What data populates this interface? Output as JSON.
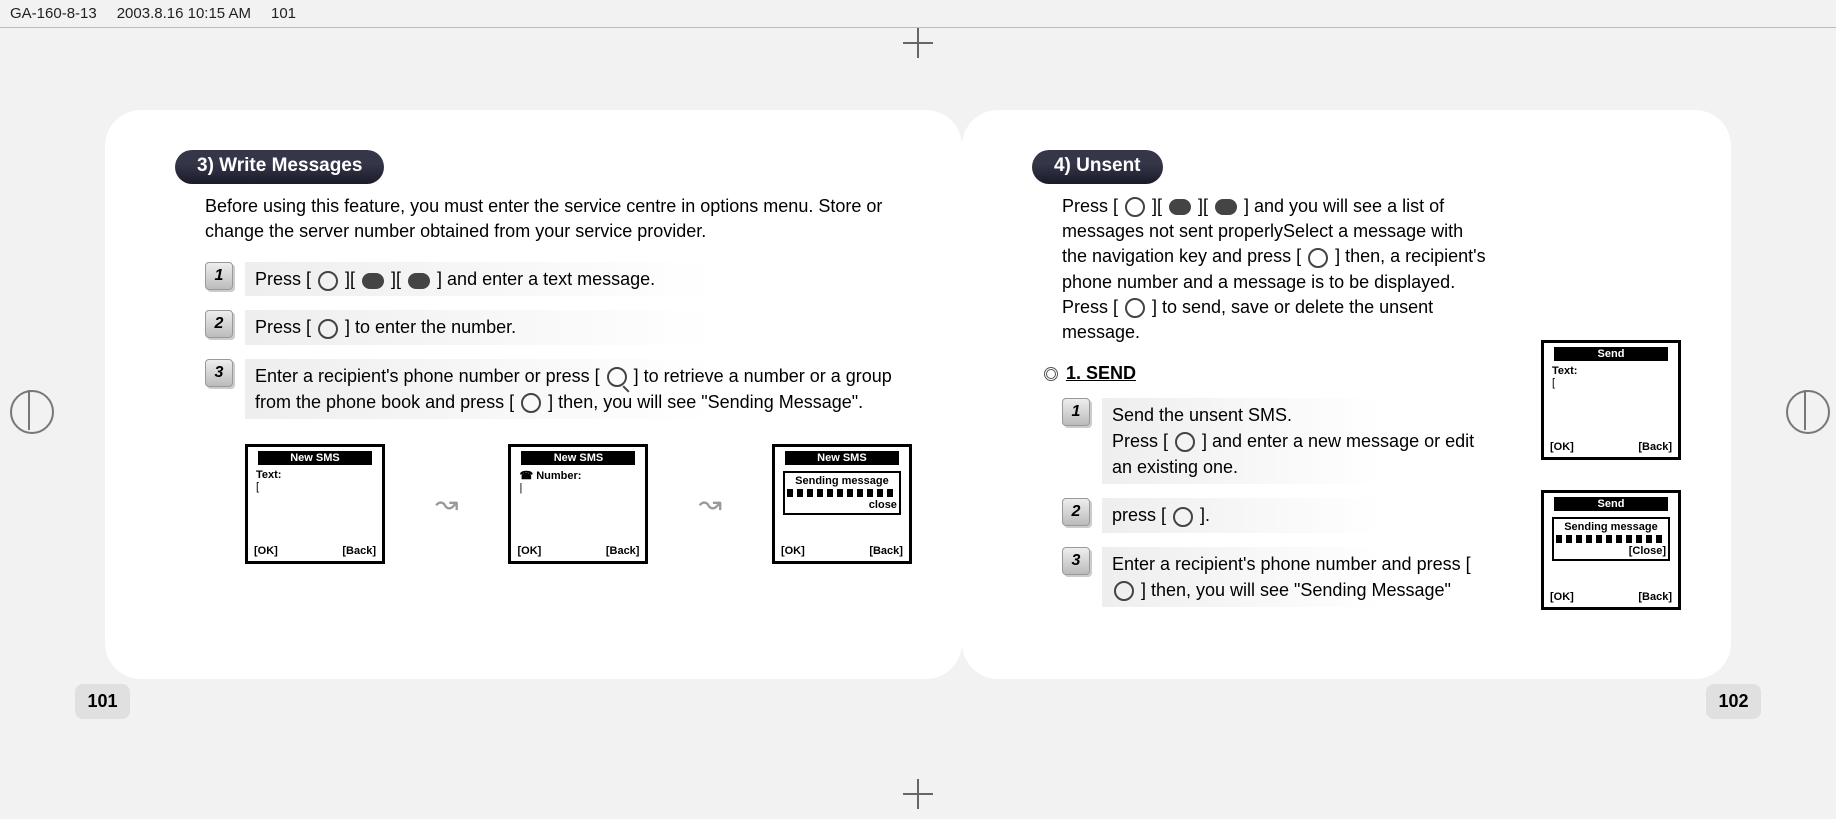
{
  "header": {
    "file": "GA-160-8-13",
    "timestamp": "2003.8.16 10:15 AM",
    "page_mark": "101"
  },
  "left": {
    "page_number": "101",
    "section_title": "3) Write Messages",
    "intro": "Before using this feature, you must enter the service centre in options menu. Store or change the server number obtained from your service provider.",
    "steps": {
      "s1": "Press [       ][       ][       ] and enter a text message.",
      "s2": "Press [       ] to enter the number.",
      "s3": "Enter a recipient's phone number or press [       ] to retrieve a number or a group from the phone book and press [       ] then, you will see “Sending Message”."
    },
    "phones": {
      "p1": {
        "title": "New SMS",
        "body_label": "Text:",
        "body_value": "[",
        "ok": "[OK]",
        "back": "[Back]"
      },
      "p2": {
        "title": "New SMS",
        "body_label": "Number:",
        "body_value": "|",
        "ok": "[OK]",
        "back": "[Back]"
      },
      "p3": {
        "title": "New SMS",
        "popup": "Sending message",
        "close": "close",
        "ok": "[OK]",
        "back": "[Back]"
      }
    }
  },
  "right": {
    "page_number": "102",
    "section_title": "4) Unsent",
    "intro": "Press [       ][       ][       ] and you will see a list of messages not sent properlySelect a message with the navigation key and press [       ] then, a recipient's phone number and a message is to be displayed. Press [       ] to send, save or delete the unsent message.",
    "subhead": "1. SEND",
    "steps": {
      "s1a": "Send the unsent SMS.",
      "s1b": "Press [       ] and enter a new message or edit an existing one.",
      "s2": "press [       ].",
      "s3": "Enter a recipient's phone number and press [       ] then, you will see “Sending Message”"
    },
    "phones": {
      "p1": {
        "title": "Send",
        "body_label": "Text:",
        "body_value": "[",
        "ok": "[OK]",
        "back": "[Back]"
      },
      "p2": {
        "title": "Send",
        "popup": "Sending message",
        "close": "[Close]",
        "ok": "[OK]",
        "back": "[Back]"
      }
    }
  }
}
